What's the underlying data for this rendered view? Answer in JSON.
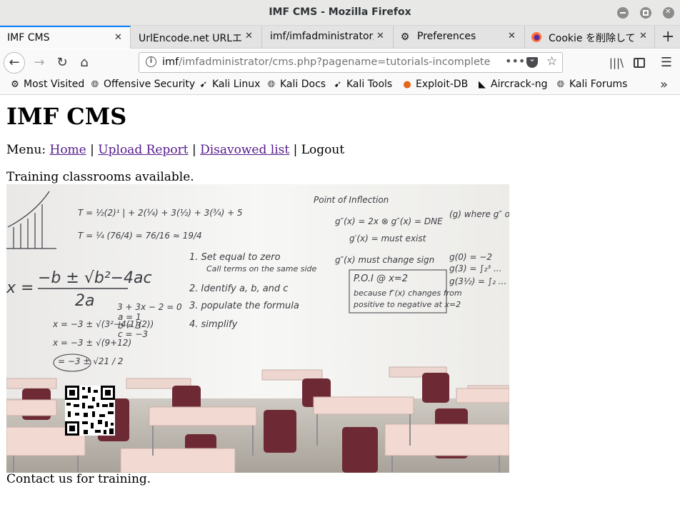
{
  "window": {
    "title": "IMF CMS - Mozilla Firefox"
  },
  "tabs": [
    {
      "label": "IMF CMS",
      "active": true
    },
    {
      "label": "UrlEncode.net URLエン"
    },
    {
      "label": "imf/imfadministrator/"
    },
    {
      "label": "Preferences",
      "icon": "gear-icon"
    },
    {
      "label": "Cookie を削除して",
      "icon": "firefox-icon"
    }
  ],
  "urlbar": {
    "host": "imf",
    "path": "/imfadministrator/cms.php?pagename=tutorials-incomplete"
  },
  "bookmarks": [
    {
      "label": "Most Visited",
      "icon": "gear-icon"
    },
    {
      "label": "Offensive Security",
      "icon": "globe-icon"
    },
    {
      "label": "Kali Linux",
      "icon": "kali-dragon-icon"
    },
    {
      "label": "Kali Docs",
      "icon": "globe-icon"
    },
    {
      "label": "Kali Tools",
      "icon": "kali-dragon-icon"
    },
    {
      "label": "Exploit-DB",
      "icon": "exploitdb-icon"
    },
    {
      "label": "Aircrack-ng",
      "icon": "aircrack-icon"
    },
    {
      "label": "Kali Forums",
      "icon": "globe-icon"
    }
  ],
  "page": {
    "heading": "IMF CMS",
    "menu_prefix": "Menu:",
    "menu": [
      {
        "label": "Home",
        "link": true
      },
      {
        "label": "Upload Report",
        "link": true
      },
      {
        "label": "Disavowed list",
        "link": true
      },
      {
        "label": "Logout",
        "link": false
      }
    ],
    "separator": "|",
    "intro": "Training classrooms available.",
    "outro": "Contact us for training.",
    "whiteboard": {
      "point_of_inflection": "Point of Inflection",
      "steps": [
        "1. Set equal to zero",
        "Call terms on the same side",
        "2. Identify a, b, and c",
        "3. populate the formula",
        "4. simplify"
      ],
      "poi": "P.O.I @ x=2",
      "quadratic_lhs": "x =",
      "quadratic_num": "−b ± √b²−4ac",
      "quadratic_den": "2a"
    }
  }
}
